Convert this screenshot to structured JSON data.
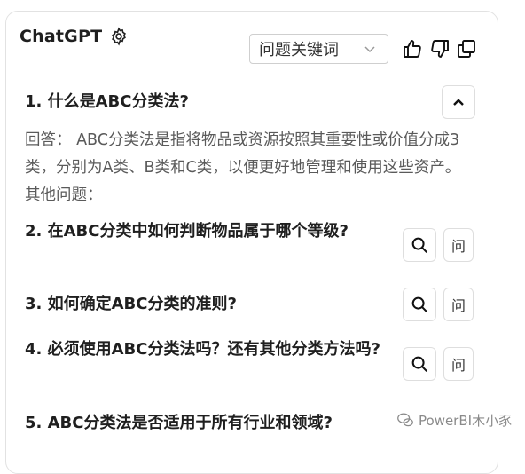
{
  "header": {
    "app_title": "ChatGPT",
    "dropdown_value": "问题关键词"
  },
  "questions": [
    {
      "number_title": "1. 什么是ABC分类法?",
      "answer": "回答： ABC分类法是指将物品或资源按照其重要性或价值分成3类，分别为A类、B类和C类，以便更好地管理和使用这些资产。 其他问题："
    },
    {
      "number_title": "2. 在ABC分类中如何判断物品属于哪个等级?",
      "ask_label": "问"
    },
    {
      "number_title": "3. 如何确定ABC分类的准则?",
      "ask_label": "问"
    },
    {
      "number_title": "4. 必须使用ABC分类法吗？还有其他分类方法吗?",
      "ask_label": "问"
    },
    {
      "number_title": "5. ABC分类法是否适用于所有行业和领域?"
    }
  ],
  "watermark": {
    "text": "PowerBI木小豕"
  },
  "colors": {
    "border": "#e2e2e2",
    "text": "#1f1f1f",
    "answer_text": "#5a5a5a"
  }
}
